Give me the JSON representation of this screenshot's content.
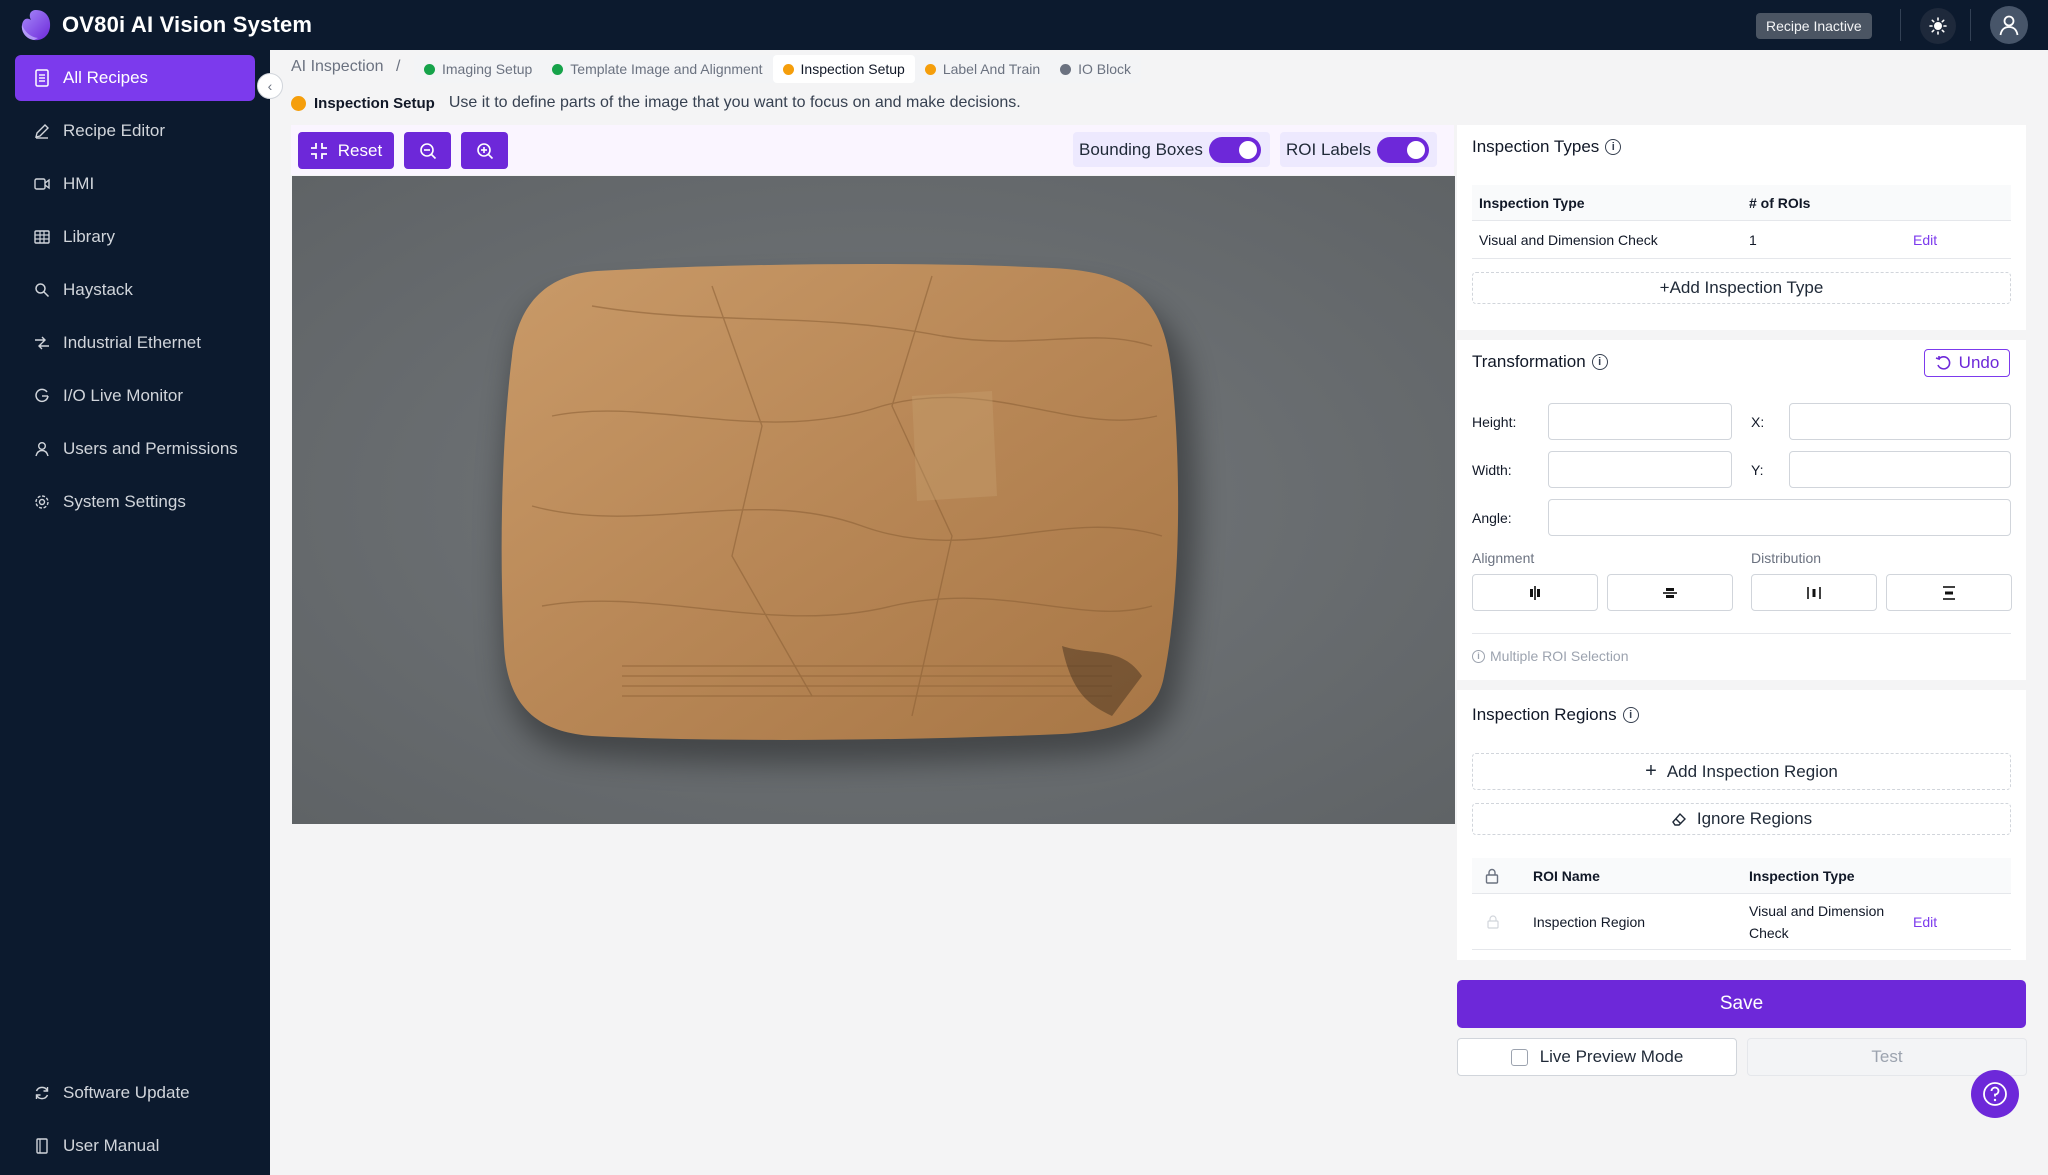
{
  "app": {
    "title": "OV80i AI Vision System",
    "recipe_status": "Recipe Inactive"
  },
  "sidebar": {
    "items": [
      {
        "label": "All Recipes",
        "icon": "document-icon",
        "active": true
      },
      {
        "label": "Recipe Editor",
        "icon": "pencil-icon"
      },
      {
        "label": "HMI",
        "icon": "video-icon"
      },
      {
        "label": "Library",
        "icon": "table-icon"
      },
      {
        "label": "Haystack",
        "icon": "search-icon"
      },
      {
        "label": "Industrial Ethernet",
        "icon": "network-icon"
      },
      {
        "label": "I/O Live Monitor",
        "icon": "monitor-icon"
      },
      {
        "label": "Users and Permissions",
        "icon": "user-icon"
      },
      {
        "label": "System Settings",
        "icon": "gear-icon"
      }
    ],
    "footer": [
      {
        "label": "Software Update",
        "icon": "refresh-icon"
      },
      {
        "label": "User Manual",
        "icon": "book-icon"
      }
    ]
  },
  "breadcrumb": {
    "root": "AI Inspection",
    "separator": "/",
    "tabs": [
      {
        "label": "Imaging Setup",
        "color": "#16a34a"
      },
      {
        "label": "Template Image and Alignment",
        "color": "#16a34a"
      },
      {
        "label": "Inspection Setup",
        "color": "#f59e0b",
        "active": true
      },
      {
        "label": "Label And Train",
        "color": "#f59e0b"
      },
      {
        "label": "IO Block",
        "color": "#6b7280"
      }
    ]
  },
  "step": {
    "title": "Inspection Setup",
    "description": "Use it to define parts of the image that you want to focus on and make decisions.",
    "color": "#f59e0b"
  },
  "toolbar": {
    "reset_label": "Reset",
    "bounding_boxes_label": "Bounding Boxes",
    "bounding_boxes_on": true,
    "roi_labels_label": "ROI Labels",
    "roi_labels_on": true
  },
  "inspection_types": {
    "title": "Inspection Types",
    "columns": [
      "Inspection Type",
      "# of ROIs"
    ],
    "rows": [
      {
        "type": "Visual and Dimension Check",
        "rois": "1",
        "action": "Edit"
      }
    ],
    "add_label": "+Add Inspection Type"
  },
  "transformation": {
    "title": "Transformation",
    "undo_label": "Undo",
    "height_label": "Height:",
    "width_label": "Width:",
    "angle_label": "Angle:",
    "x_label": "X:",
    "y_label": "Y:",
    "alignment_label": "Alignment",
    "distribution_label": "Distribution",
    "multi_roi_label": "Multiple ROI Selection"
  },
  "inspection_regions": {
    "title": "Inspection Regions",
    "add_label": "Add Inspection Region",
    "ignore_label": "Ignore Regions",
    "columns": [
      "ROI Name",
      "Inspection Type"
    ],
    "rows": [
      {
        "name": "Inspection Region",
        "type_line1": "Visual and Dimension",
        "type_line2": "Check",
        "action": "Edit"
      }
    ]
  },
  "actions": {
    "save_label": "Save",
    "live_preview_label": "Live Preview Mode",
    "test_label": "Test"
  },
  "colors": {
    "accent": "#6d28d9",
    "sidebar_bg": "#0c1a2e",
    "active_nav": "#7c3aed"
  }
}
